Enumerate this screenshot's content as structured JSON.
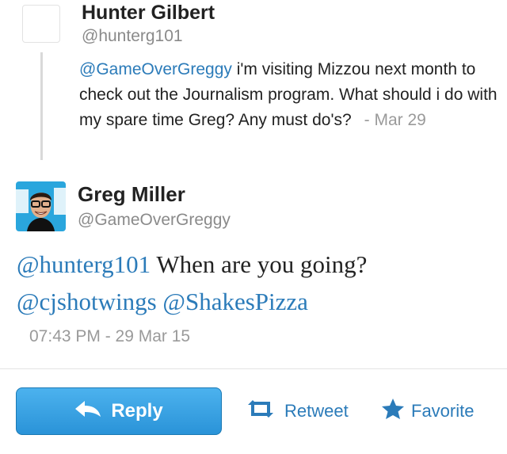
{
  "reply_to_tweet": {
    "author_name": "Hunter Gilbert",
    "author_handle": "@hunterg101",
    "mention": "@GameOverGreggy",
    "text": " i'm visiting Mizzou next month to check out the Journalism program. What should i do with my spare time Greg? Any must do's?",
    "time": "- Mar 29"
  },
  "main_tweet": {
    "author_name": "Greg Miller",
    "author_handle": "@GameOverGreggy",
    "mention_1": "@hunterg101",
    "text": " When are you going?",
    "mention_2": "@cjshotwings",
    "mention_3": "@ShakesPizza",
    "timestamp": "07:43 PM - 29 Mar 15"
  },
  "actions": {
    "reply_label": "Reply",
    "retweet_label": "Retweet",
    "favorite_label": "Favorite"
  },
  "colors": {
    "link": "#2b7bb9",
    "reply_button": "#2a93d8",
    "secondary_text": "#8a8a8a"
  },
  "icons": {
    "reply": "reply-arrow-icon",
    "retweet": "retweet-icon",
    "favorite": "star-icon"
  }
}
